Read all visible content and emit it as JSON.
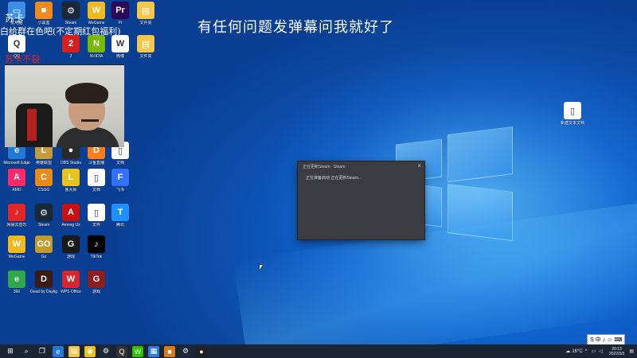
{
  "overlay": {
    "stream_message": "有任何问题发弹幕问我就好了",
    "top_text": "苏卡",
    "group_text": "白给群在色吧(不定期红包福利)",
    "name_text": "苏卡不裂"
  },
  "desktop_icons": [
    {
      "label": "此电脑",
      "color": "#3a8ee6",
      "glyph": "▭"
    },
    {
      "label": "小黑盒",
      "color": "#f08a1c",
      "glyph": "■"
    },
    {
      "label": "Steam",
      "color": "#1b2838",
      "glyph": "⚙"
    },
    {
      "label": "WeGame",
      "color": "#f1b91e",
      "glyph": "W"
    },
    {
      "label": "Pr",
      "color": "#2b0a5c",
      "glyph": "Pr"
    },
    {
      "label": "文件夹",
      "color": "#f4c74a",
      "glyph": "▤"
    },
    {
      "label": "QQ",
      "color": "#ffffff",
      "glyph": "Q"
    },
    {
      "label": "2",
      "color": "#d81e1e",
      "glyph": "2"
    },
    {
      "label": "NVIDIA",
      "color": "#76b900",
      "glyph": "N"
    },
    {
      "label": "微博",
      "color": "#ffffff",
      "glyph": "W"
    },
    {
      "label": "文件夹",
      "color": "#f4c74a",
      "glyph": "▤"
    },
    {
      "label": "Microsoft Edge",
      "color": "#1f7ad8",
      "glyph": "e"
    },
    {
      "label": "英雄联盟",
      "color": "#c69b3a",
      "glyph": "L"
    },
    {
      "label": "OBS Studio",
      "color": "#2b2b2b",
      "glyph": "●"
    },
    {
      "label": "斗鱼直播",
      "color": "#ff7d1a",
      "glyph": "D"
    },
    {
      "label": "文档",
      "color": "#ffffff",
      "glyph": "▯"
    },
    {
      "label": "AMD",
      "color": "#ff2a6a",
      "glyph": "A"
    },
    {
      "label": "CSGO",
      "color": "#e88a1c",
      "glyph": "C"
    },
    {
      "label": "鲁大师",
      "color": "#e8c21e",
      "glyph": "L"
    },
    {
      "label": "文档",
      "color": "#ffffff",
      "glyph": "▯"
    },
    {
      "label": "飞书",
      "color": "#3370ff",
      "glyph": "F"
    },
    {
      "label": "网易云音乐",
      "color": "#e02626",
      "glyph": "♪"
    },
    {
      "label": "Steam",
      "color": "#1b2838",
      "glyph": "⚙"
    },
    {
      "label": "Among Us",
      "color": "#c51111",
      "glyph": "A"
    },
    {
      "label": "文件",
      "color": "#ffffff",
      "glyph": "▯"
    },
    {
      "label": "腾讯",
      "color": "#1e90ff",
      "glyph": "T"
    },
    {
      "label": "WeGame",
      "color": "#f1b91e",
      "glyph": "W"
    },
    {
      "label": "Go",
      "color": "#c09a2a",
      "glyph": "GO"
    },
    {
      "label": "游戏",
      "color": "#1a1a1a",
      "glyph": "G"
    },
    {
      "label": "TikTok",
      "color": "#000000",
      "glyph": "♪"
    },
    {
      "label": "360",
      "color": "#2ea84a",
      "glyph": "e"
    },
    {
      "label": "Dead by Daylight",
      "color": "#3b1a1a",
      "glyph": "D"
    },
    {
      "label": "WPS Office",
      "color": "#d8262f",
      "glyph": "W"
    },
    {
      "label": "游戏",
      "color": "#8a1e1e",
      "glyph": "G"
    },
    {
      "label": "新建文本文档",
      "color": "#ffffff",
      "glyph": "▯"
    }
  ],
  "steam_dialog": {
    "title": "正在更新Steam - Steam",
    "close": "×",
    "body": "正在准备启动 正在更新Steam..."
  },
  "taskbar": {
    "icons": [
      {
        "name": "start",
        "glyph": "⊞",
        "color": "#1c2533"
      },
      {
        "name": "search",
        "glyph": "⌕",
        "color": "#1c2533"
      },
      {
        "name": "task-view",
        "glyph": "❐",
        "color": "#1c2533"
      },
      {
        "name": "edge",
        "glyph": "e",
        "color": "#1f7ad8"
      },
      {
        "name": "explorer",
        "glyph": "▤",
        "color": "#f4c74a"
      },
      {
        "name": "app",
        "glyph": "◉",
        "color": "#e8c21e"
      },
      {
        "name": "steam",
        "glyph": "⚙",
        "color": "#1b2838"
      },
      {
        "name": "qq",
        "glyph": "Q",
        "color": "#333333"
      },
      {
        "name": "wechat",
        "glyph": "W",
        "color": "#2dc100"
      },
      {
        "name": "store",
        "glyph": "▦",
        "color": "#2f7bd8"
      },
      {
        "name": "app2",
        "glyph": "■",
        "color": "#d87a1c"
      },
      {
        "name": "steam2",
        "glyph": "⚙",
        "color": "#1b2838"
      },
      {
        "name": "obs",
        "glyph": "●",
        "color": "#222222"
      }
    ],
    "temperature": "16°C",
    "time": "20:13",
    "date": "2022/3/3"
  },
  "ime": {
    "items": [
      "S",
      "中",
      "♪",
      "☺",
      "⌨"
    ]
  }
}
